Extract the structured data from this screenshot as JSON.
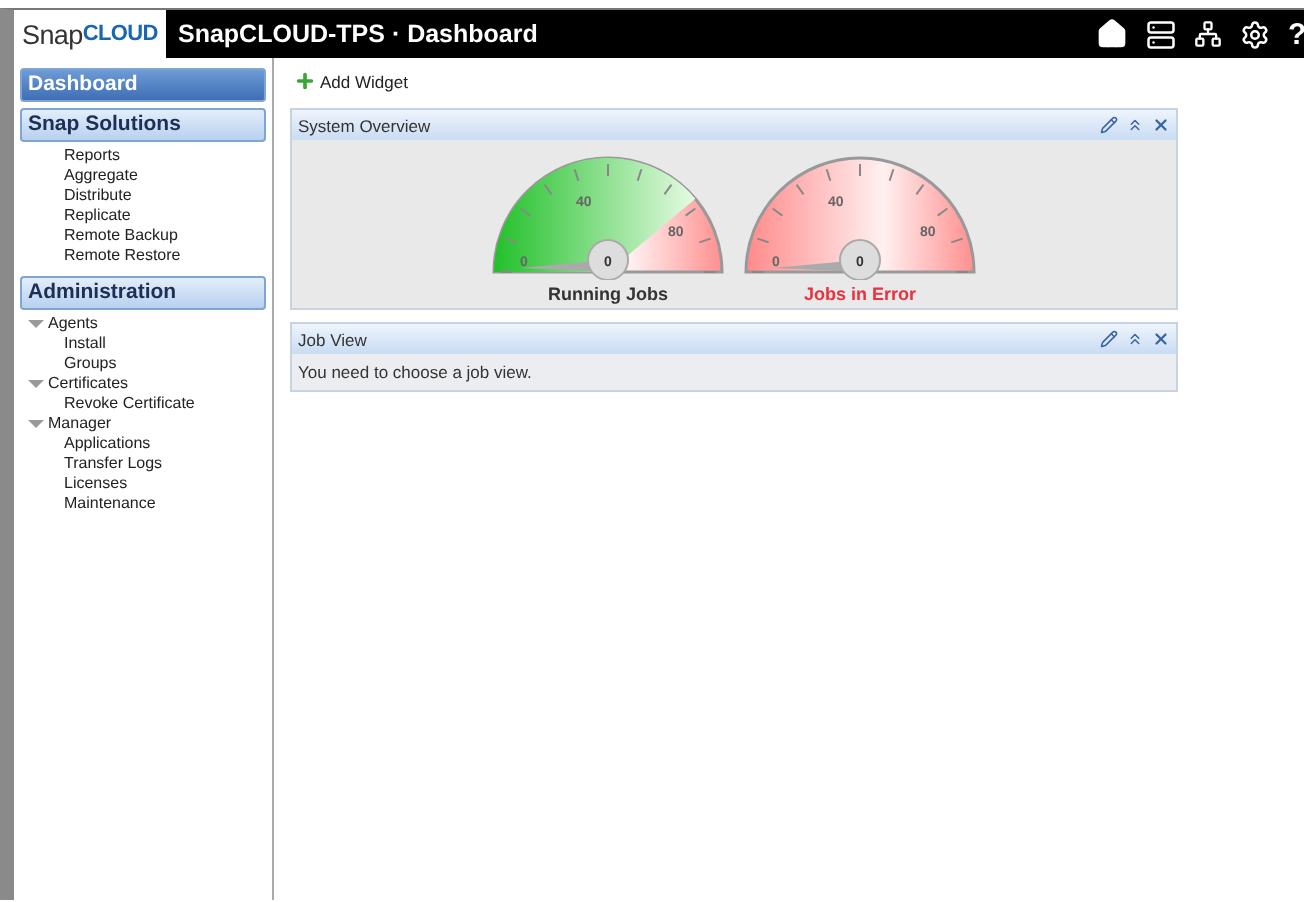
{
  "header": {
    "logo_prefix": "Snap",
    "logo_suffix": "CLOUD",
    "title": "SnapCLOUD-TPS · Dashboard",
    "help": "?"
  },
  "sidebar": {
    "sections": [
      {
        "title": "Dashboard",
        "selected": true
      },
      {
        "title": "Snap Solutions",
        "selected": false,
        "items": [
          {
            "label": "Reports"
          },
          {
            "label": "Aggregate"
          },
          {
            "label": "Distribute"
          },
          {
            "label": "Replicate"
          },
          {
            "label": "Remote Backup"
          },
          {
            "label": "Remote Restore"
          }
        ]
      },
      {
        "title": "Administration",
        "selected": false,
        "items": [
          {
            "label": "Agents",
            "expanded": true,
            "children": [
              {
                "label": "Install"
              },
              {
                "label": "Groups"
              }
            ]
          },
          {
            "label": "Certificates",
            "expanded": true,
            "children": [
              {
                "label": "Revoke Certificate"
              }
            ]
          },
          {
            "label": "Manager",
            "expanded": true,
            "children": [
              {
                "label": "Applications"
              },
              {
                "label": "Transfer Logs"
              },
              {
                "label": "Licenses"
              },
              {
                "label": "Maintenance"
              }
            ]
          }
        ]
      }
    ]
  },
  "toolbar": {
    "add_widget": "Add Widget"
  },
  "widgets": [
    {
      "title": "System Overview",
      "kind": "gauges",
      "gauges": [
        {
          "kind": "running",
          "label": "Running Jobs",
          "value": "0",
          "ticks": [
            "0",
            "40",
            "80"
          ]
        },
        {
          "kind": "error",
          "label": "Jobs in Error",
          "value": "0",
          "ticks": [
            "0",
            "40",
            "80"
          ]
        }
      ]
    },
    {
      "title": "Job View",
      "kind": "message",
      "message": "You need to choose a job view."
    }
  ]
}
